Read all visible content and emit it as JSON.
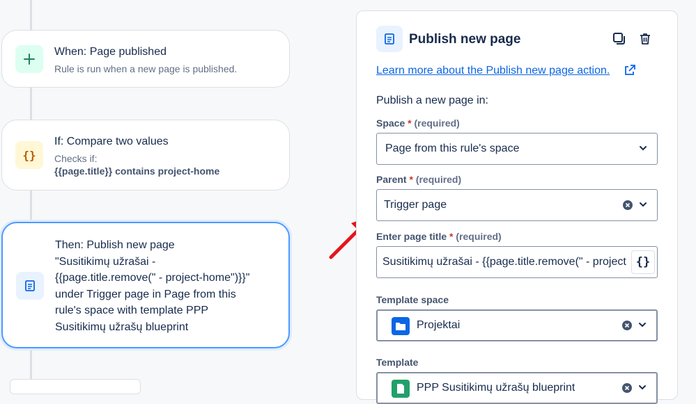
{
  "flow": {
    "trigger": {
      "title": "When: Page published",
      "subtitle": "Rule is run when a new page is published."
    },
    "condition": {
      "title": "If: Compare two values",
      "subtitle": "Checks if:",
      "detail": "{{page.title}} contains project-home",
      "icon_text": "{}"
    },
    "action": {
      "lines": [
        "Then: Publish new page",
        "\"Susitikimų užrašai -",
        "{{page.title.remove(\" - project-home\")}}\"",
        "under Trigger page in Page from this",
        "rule's space with template PPP",
        "Susitikimų užrašų blueprint"
      ]
    }
  },
  "panel": {
    "title": "Publish new page",
    "learn_link": "Learn more about the Publish new page action.",
    "intro": "Publish a new page in:",
    "required_star": "*",
    "required_text": "(required)",
    "space": {
      "label": "Space",
      "value": "Page from this rule's space"
    },
    "parent": {
      "label": "Parent",
      "value": "Trigger page"
    },
    "page_title": {
      "label": "Enter page title",
      "value": "Susitikimų užrašai - {{page.title.remove(\" - project-home\")}}",
      "braces": "{}"
    },
    "template_space": {
      "label": "Template space",
      "value": "Projektai"
    },
    "template": {
      "label": "Template",
      "value": "PPP Susitikimų užrašų blueprint"
    }
  },
  "icons": {
    "trigger": "plus-icon",
    "condition": "braces-icon",
    "action": "page-icon",
    "duplicate": "duplicate-icon",
    "delete": "trash-icon",
    "external": "external-link-icon",
    "clear": "clear-icon",
    "chevron": "chevron-down-icon"
  },
  "colors": {
    "link": "#0c66e4",
    "selected_border": "#4c9aff",
    "annotation_arrow": "#e5141b"
  }
}
